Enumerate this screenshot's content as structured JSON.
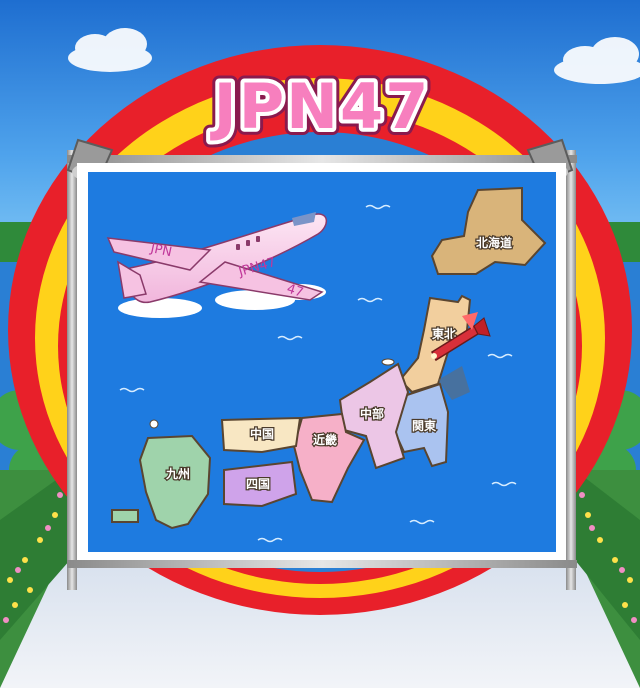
{
  "game": {
    "title": "JPN47"
  },
  "plane": {
    "body_text": "JPN",
    "tail_text": "JPN47",
    "fin_number": "47"
  },
  "map": {
    "regions": [
      {
        "id": "hokkaido",
        "label": "北海道",
        "color": "#d9b47a"
      },
      {
        "id": "tohoku",
        "label": "東北",
        "color": "#f2cf9e"
      },
      {
        "id": "kanto",
        "label": "関東",
        "color": "#aac3f0"
      },
      {
        "id": "chubu",
        "label": "中部",
        "color": "#ecc6e6"
      },
      {
        "id": "kinki",
        "label": "近畿",
        "color": "#f6b0c8"
      },
      {
        "id": "chugoku",
        "label": "中国",
        "color": "#f8e7c3"
      },
      {
        "id": "shikoku",
        "label": "四国",
        "color": "#cfa3ea"
      },
      {
        "id": "kyushu",
        "label": "九州",
        "color": "#9fd3ab"
      }
    ]
  },
  "colors": {
    "sky": "#2a7fd4",
    "sea": "#1e7be0",
    "title_fill": "#f77fbe",
    "arch_red": "#e8202a",
    "arch_yellow": "#ffd21a"
  }
}
